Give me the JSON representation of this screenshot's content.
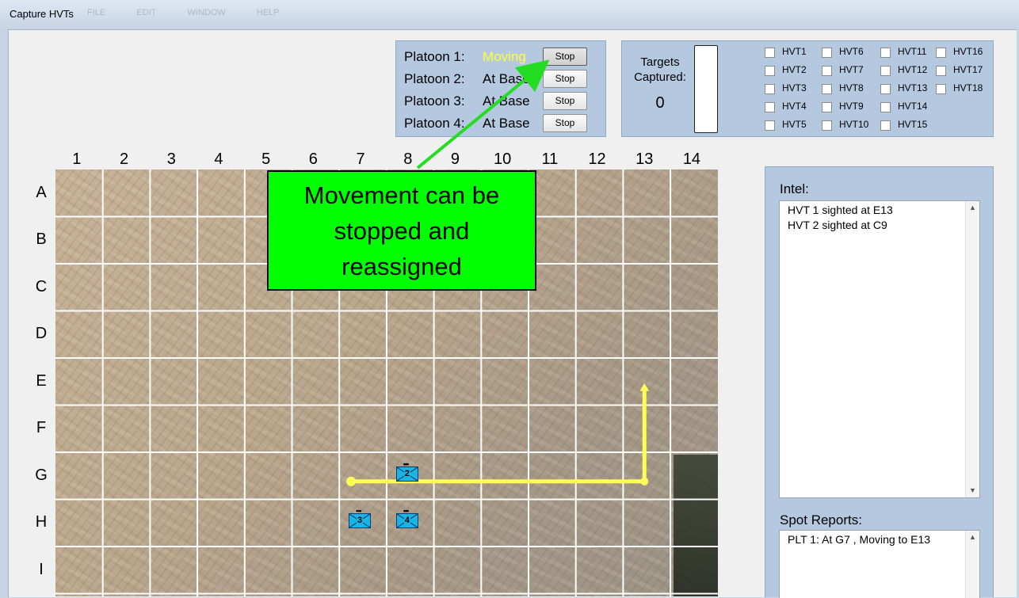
{
  "window": {
    "title": "Capture HVTs",
    "menu": [
      "FILE",
      "EDIT",
      "WINDOW",
      "HELP"
    ]
  },
  "platoons": [
    {
      "label": "Platoon 1:",
      "status": "Moving",
      "button": "Stop"
    },
    {
      "label": "Platoon 2:",
      "status": "At Base",
      "button": "Stop"
    },
    {
      "label": "Platoon 3:",
      "status": "At Base",
      "button": "Stop"
    },
    {
      "label": "Platoon 4:",
      "status": "At Base",
      "button": "Stop"
    }
  ],
  "targets": {
    "label": "Targets Captured:",
    "count": "0",
    "hvts": [
      "HVT1",
      "HVT2",
      "HVT3",
      "HVT4",
      "HVT5",
      "HVT6",
      "HVT7",
      "HVT8",
      "HVT9",
      "HVT10",
      "HVT11",
      "HVT12",
      "HVT13",
      "HVT14",
      "HVT15",
      "HVT16",
      "HVT17",
      "HVT18"
    ]
  },
  "map": {
    "columns": [
      "1",
      "2",
      "3",
      "4",
      "5",
      "6",
      "7",
      "8",
      "9",
      "10",
      "11",
      "12",
      "13",
      "14"
    ],
    "rows": [
      "A",
      "B",
      "C",
      "D",
      "E",
      "F",
      "G",
      "H",
      "I"
    ],
    "units": [
      {
        "label": "2",
        "cell": "G8"
      },
      {
        "label": "3",
        "cell": "H7"
      },
      {
        "label": "4",
        "cell": "H8"
      }
    ],
    "route": {
      "from": "G7",
      "corner": "G13",
      "to": "E13",
      "color": "#ffff55"
    }
  },
  "callout": {
    "text": "Movement can be stopped and reassigned",
    "color": "#00ff00"
  },
  "intel": {
    "label": "Intel:",
    "items": [
      "HVT 1 sighted at E13",
      "HVT 2 sighted at C9"
    ]
  },
  "spot_reports": {
    "label": "Spot Reports:",
    "items": [
      "PLT 1:  At G7 , Moving to E13"
    ]
  }
}
